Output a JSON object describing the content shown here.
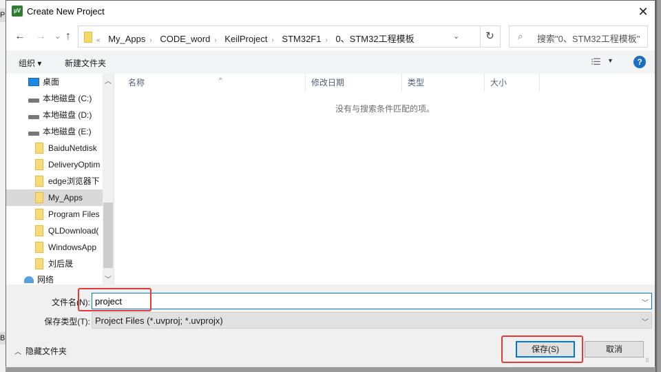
{
  "background": {
    "left_letter_top": "P",
    "left_letter_bottom": "B"
  },
  "window": {
    "title": "Create New Project",
    "app_icon": "uvision-icon",
    "close_glyph": "✕"
  },
  "nav": {
    "back": "←",
    "forward": "→",
    "recent": "⌄",
    "up": "↑",
    "breadcrumb_prefix": "«",
    "breadcrumbs": [
      "My_Apps",
      "CODE_word",
      "KeilProject",
      "STM32F1",
      "0、STM32工程模板"
    ],
    "separator": "›",
    "refresh": "↻",
    "search_placeholder": "搜索\"0、STM32工程模板\""
  },
  "toolbar": {
    "organize": "组织 ▾",
    "new_folder": "新建文件夹",
    "help": "?"
  },
  "sidebar": {
    "items": [
      {
        "label": "桌面",
        "icon": "desktop-icon"
      },
      {
        "label": "本地磁盘 (C:)",
        "icon": "drive-icon"
      },
      {
        "label": "本地磁盘 (D:)",
        "icon": "drive-icon"
      },
      {
        "label": "本地磁盘 (E:)",
        "icon": "drive-icon"
      },
      {
        "label": "BaiduNetdisk",
        "icon": "folder-icon"
      },
      {
        "label": "DeliveryOptim",
        "icon": "folder-icon"
      },
      {
        "label": "edge浏览器下",
        "icon": "folder-icon"
      },
      {
        "label": "My_Apps",
        "icon": "folder-icon",
        "selected": true
      },
      {
        "label": "Program Files",
        "icon": "folder-icon"
      },
      {
        "label": "QLDownload(",
        "icon": "folder-icon"
      },
      {
        "label": "WindowsApp",
        "icon": "folder-icon"
      },
      {
        "label": "刘后晟",
        "icon": "folder-icon"
      },
      {
        "label": "网络",
        "icon": "network-icon"
      }
    ]
  },
  "content": {
    "columns": [
      "名称",
      "修改日期",
      "类型",
      "大小"
    ],
    "empty_message": "没有与搜索条件匹配的项。"
  },
  "form": {
    "filename_label": "文件名(N):",
    "filename_value": "project",
    "filetype_label": "保存类型(T):",
    "filetype_value": "Project Files (*.uvproj; *.uvprojx)",
    "hide_folders": "隐藏文件夹",
    "save": "保存(S)",
    "cancel": "取消"
  },
  "colors": {
    "accent": "#0078d7",
    "highlight": "#e53935",
    "help": "#1b6fc2"
  }
}
